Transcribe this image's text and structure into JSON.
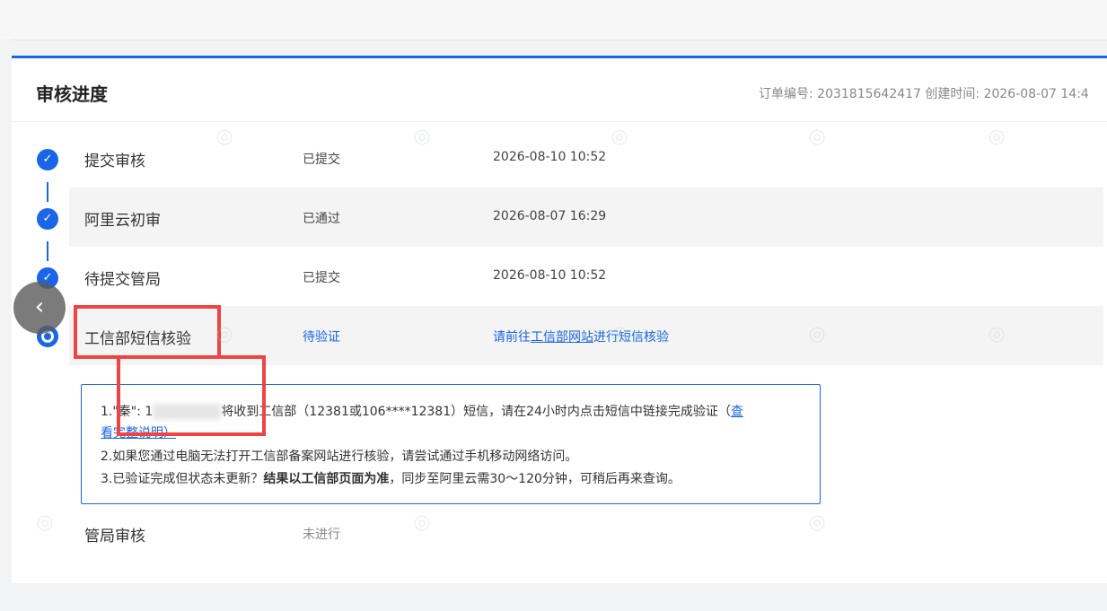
{
  "header": {
    "title": "审核进度",
    "meta": "订单编号: 2031815642417   创建时间: 2026-08-07 14:4"
  },
  "steps": [
    {
      "name": "提交审核",
      "status": "已提交",
      "time": "2026-08-10 10:52"
    },
    {
      "name": "阿里云初审",
      "status": "已通过",
      "time": "2026-08-07 16:29"
    },
    {
      "name": "待提交管局",
      "status": "已提交",
      "time": "2026-08-10 10:52"
    },
    {
      "name": "工信部短信核验",
      "status": "待验证",
      "action_prefix": "请前往",
      "action_link": "工信部网站",
      "action_suffix": "进行短信核验"
    },
    {
      "name": "管局审核",
      "status": "未进行"
    }
  ],
  "notice": {
    "line1_a": "1.\"秦\": 1",
    "line1_b": "将收到工信部（12381或106****12381）短信，请在24小时内点击短信中链接完成验证（",
    "line1_link": "查",
    "line1_link2": "看完整说明）",
    "line2": "2.如果您通过电脑无法打开工信部备案网站进行核验，请尝试通过手机移动网络访问。",
    "line3_a": "3.已验证完成但状态未更新？",
    "line3_bold": "结果以工信部页面为准",
    "line3_b": "，同步至阿里云需30～120分钟，可稍后再来查询。"
  },
  "icons": {
    "check": "check-icon",
    "current": "current-step-icon",
    "nav": "chevron-left-icon"
  },
  "colors": {
    "accent": "#1a66e8",
    "highlight": "#ee4444"
  }
}
